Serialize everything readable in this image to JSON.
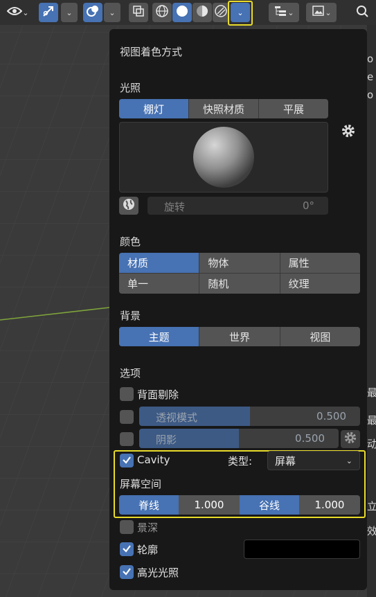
{
  "popover": {
    "title": "视图着色方式",
    "lighting": {
      "heading": "光照",
      "options": [
        "棚灯",
        "快照材质",
        "平展"
      ],
      "selected": "棚灯",
      "rotation_label": "旋转",
      "rotation_value": "0°"
    },
    "color": {
      "heading": "颜色",
      "options": [
        "材质",
        "物体",
        "属性",
        "单一",
        "随机",
        "纹理"
      ],
      "selected": "材质"
    },
    "background": {
      "heading": "背景",
      "options": [
        "主题",
        "世界",
        "视图"
      ],
      "selected": "主题"
    },
    "options": {
      "heading": "选项",
      "backface_culling": {
        "label": "背面剔除",
        "checked": false
      },
      "xray": {
        "label": "透视模式",
        "value": "0.500",
        "fraction": 0.5,
        "checked": false
      },
      "shadow": {
        "label": "阴影",
        "value": "0.500",
        "fraction": 0.5,
        "checked": false
      },
      "cavity": {
        "label": "Cavity",
        "checked": true,
        "type_label": "类型:",
        "type_value": "屏幕",
        "screen_space_label": "屏幕空间",
        "ridge_label": "脊线",
        "ridge_value": "1.000",
        "valley_label": "谷线",
        "valley_value": "1.000"
      },
      "depth_of_field": {
        "label": "景深",
        "checked": false
      },
      "outline": {
        "label": "轮廓",
        "checked": true,
        "color": "#000000"
      },
      "specular": {
        "label": "高光光照",
        "checked": true
      }
    }
  },
  "right_strip_chars": [
    "o",
    "e",
    "o",
    "最",
    "最",
    "动",
    "立",
    "效"
  ],
  "colors": {
    "accent": "#4772b3",
    "highlight": "#e9dc2a",
    "panel": "#181818",
    "widget": "#545454"
  }
}
